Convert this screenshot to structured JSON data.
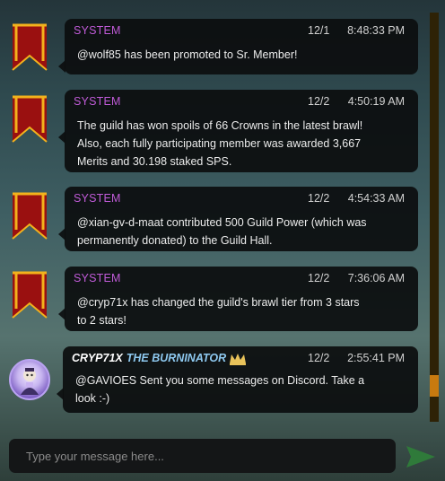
{
  "messages": [
    {
      "sender": "SYSTEM",
      "date": "12/1",
      "time": "8:48:33 PM",
      "lines": [
        "@wolf85 has been promoted to Sr. Member!"
      ]
    },
    {
      "sender": "SYSTEM",
      "date": "12/2",
      "time": "4:50:19 AM",
      "lines": [
        "The guild has won spoils of 66 Crowns in the latest brawl!",
        "Also, each fully participating member was awarded 3,667",
        "Merits and 30.198 staked SPS."
      ]
    },
    {
      "sender": "SYSTEM",
      "date": "12/2",
      "time": "4:54:33 AM",
      "lines": [
        "@xian-gv-d-maat contributed 500 Guild Power (which was",
        "permanently donated) to the Guild Hall."
      ]
    },
    {
      "sender": "SYSTEM",
      "date": "12/2",
      "time": "7:36:06 AM",
      "lines": [
        "@cryp71x has changed the guild's brawl tier from 3 stars",
        "to 2 stars!"
      ]
    },
    {
      "sender": "CRYP71X",
      "sender_title": "THE BURNINATOR",
      "date": "12/2",
      "time": "2:55:41 PM",
      "lines": [
        "@GAVIOES Sent you some messages on Discord. Take a",
        "look :-)"
      ]
    }
  ],
  "icons": {
    "system_avatar": "guild-banner-icon",
    "user_avatar": "user-avatar",
    "crown": "crown-icon",
    "send": "send-arrow-icon"
  },
  "composer": {
    "placeholder": "Type your message here..."
  },
  "colors": {
    "system_sender": "#c05bd8",
    "user_title": "#8ec9f0",
    "crown": "#e8c25a",
    "scroll_thumb": "#c87a0f",
    "send_arrow": "#2f7a3a"
  }
}
